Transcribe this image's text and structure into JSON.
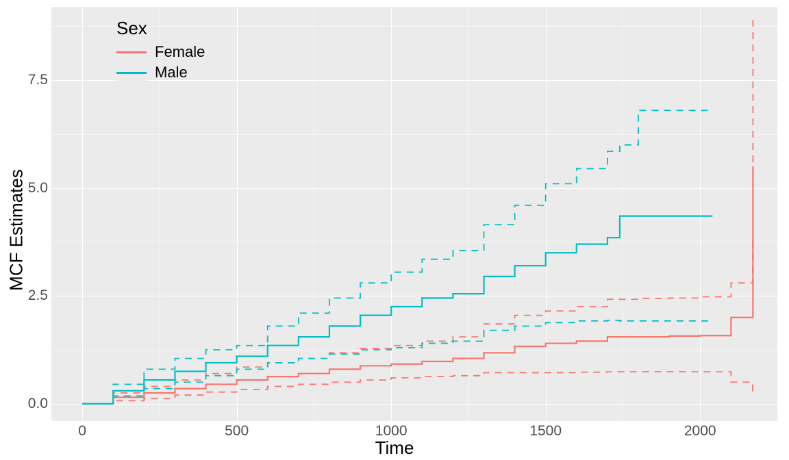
{
  "chart_data": {
    "type": "line",
    "title": "",
    "xlabel": "Time",
    "ylabel": "MCF Estimates",
    "xlim": [
      -100,
      2250
    ],
    "ylim": [
      -0.4,
      9.2
    ],
    "x_ticks": [
      0,
      500,
      1000,
      1500,
      2000
    ],
    "y_ticks": [
      0.0,
      2.5,
      5.0,
      7.5
    ],
    "legend_title": "Sex",
    "legend_position": "top-left",
    "colors": {
      "Female": "#F8766D",
      "Male": "#00BFC4"
    },
    "series": [
      {
        "name": "Female",
        "style": "solid",
        "role": "estimate",
        "x": [
          0,
          100,
          200,
          300,
          400,
          500,
          600,
          700,
          800,
          900,
          1000,
          1100,
          1200,
          1300,
          1400,
          1500,
          1600,
          1700,
          1800,
          1900,
          2000,
          2100,
          2170,
          2171
        ],
        "y": [
          0.0,
          0.15,
          0.25,
          0.35,
          0.45,
          0.55,
          0.63,
          0.7,
          0.8,
          0.88,
          0.92,
          0.98,
          1.05,
          1.18,
          1.33,
          1.4,
          1.45,
          1.55,
          1.55,
          1.57,
          1.58,
          2.0,
          2.0,
          5.5
        ]
      },
      {
        "name": "Female",
        "style": "dashed",
        "role": "upper",
        "x": [
          0,
          100,
          200,
          300,
          400,
          500,
          600,
          700,
          800,
          900,
          1000,
          1100,
          1200,
          1300,
          1400,
          1500,
          1600,
          1700,
          1800,
          1900,
          2000,
          2100,
          2170,
          2171
        ],
        "y": [
          0.0,
          0.25,
          0.4,
          0.55,
          0.7,
          0.85,
          0.95,
          1.05,
          1.18,
          1.28,
          1.35,
          1.45,
          1.55,
          1.85,
          2.05,
          2.15,
          2.25,
          2.42,
          2.44,
          2.45,
          2.48,
          2.8,
          3.85,
          9.0
        ]
      },
      {
        "name": "Female",
        "style": "dashed",
        "role": "lower",
        "x": [
          0,
          100,
          200,
          300,
          400,
          500,
          600,
          700,
          800,
          900,
          1000,
          1100,
          1200,
          1300,
          1400,
          1500,
          1600,
          1700,
          1800,
          1900,
          2000,
          2100,
          2170
        ],
        "y": [
          0.0,
          0.07,
          0.12,
          0.2,
          0.27,
          0.33,
          0.4,
          0.45,
          0.5,
          0.55,
          0.6,
          0.63,
          0.65,
          0.72,
          0.72,
          0.72,
          0.73,
          0.74,
          0.74,
          0.74,
          0.74,
          0.5,
          0.25
        ]
      },
      {
        "name": "Male",
        "style": "solid",
        "role": "estimate",
        "x": [
          0,
          100,
          200,
          300,
          400,
          500,
          600,
          700,
          800,
          900,
          1000,
          1100,
          1200,
          1300,
          1400,
          1500,
          1600,
          1700,
          1740,
          1800,
          1900,
          2000,
          2040
        ],
        "y": [
          0.0,
          0.3,
          0.55,
          0.75,
          0.95,
          1.1,
          1.35,
          1.55,
          1.8,
          2.05,
          2.25,
          2.45,
          2.55,
          2.95,
          3.2,
          3.5,
          3.7,
          3.85,
          4.35,
          4.35,
          4.35,
          4.35,
          4.35
        ]
      },
      {
        "name": "Male",
        "style": "dashed",
        "role": "upper",
        "x": [
          0,
          100,
          200,
          300,
          400,
          500,
          600,
          700,
          800,
          900,
          1000,
          1100,
          1200,
          1300,
          1400,
          1500,
          1600,
          1700,
          1740,
          1800,
          1900,
          2000,
          2040
        ],
        "y": [
          0.0,
          0.45,
          0.8,
          1.05,
          1.25,
          1.35,
          1.8,
          2.1,
          2.45,
          2.8,
          3.05,
          3.35,
          3.55,
          4.15,
          4.6,
          5.1,
          5.45,
          5.85,
          6.0,
          6.8,
          6.8,
          6.8,
          6.8
        ]
      },
      {
        "name": "Male",
        "style": "dashed",
        "role": "lower",
        "x": [
          0,
          100,
          200,
          300,
          400,
          500,
          600,
          700,
          800,
          900,
          1000,
          1100,
          1200,
          1300,
          1400,
          1500,
          1600,
          1700,
          1740,
          1800,
          1900,
          2000,
          2040
        ],
        "y": [
          0.0,
          0.18,
          0.35,
          0.5,
          0.65,
          0.8,
          0.95,
          1.05,
          1.15,
          1.25,
          1.3,
          1.4,
          1.45,
          1.7,
          1.8,
          1.88,
          1.92,
          1.93,
          1.92,
          1.92,
          1.92,
          1.92,
          1.92
        ]
      }
    ]
  }
}
